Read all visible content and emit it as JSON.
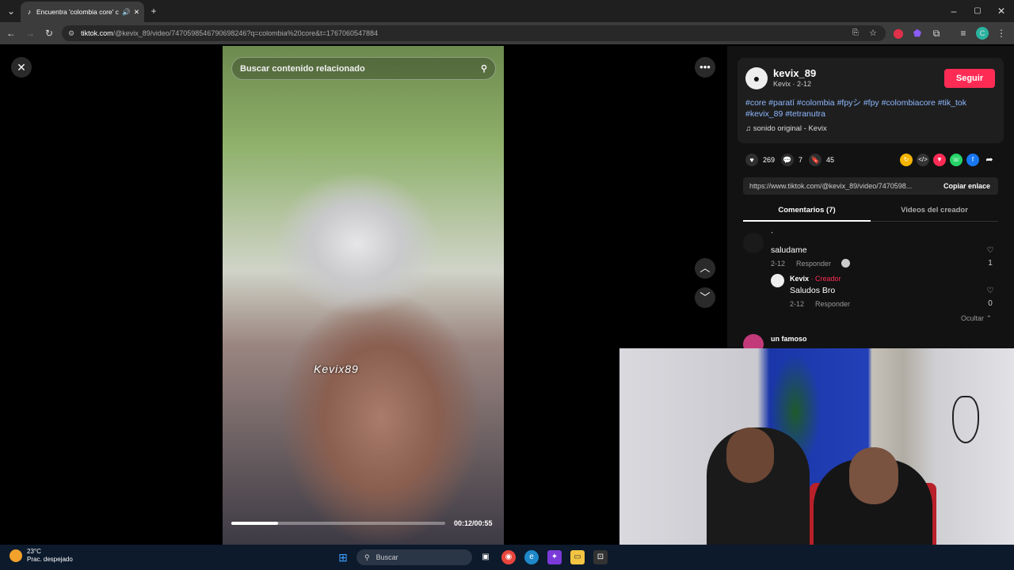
{
  "browser": {
    "tab_title": "Encuentra 'colombia core' c",
    "url_host": "tiktok.com",
    "url_path": "/@kevix_89/video/7470598546790698246?q=colombia%20core&t=1767060547884"
  },
  "video": {
    "search_placeholder": "Buscar contenido relacionado",
    "watermark": "Kevix89",
    "timecode": "00:12/00:55",
    "progress": 0.22
  },
  "creator": {
    "username": "kevix_89",
    "subline": "Kevix · 2-12",
    "follow_label": "Seguir",
    "description": "#core #paratí #colombia #fpyシ #fpy #colombiacore #tik_tok #kevix_89 #tetranutra",
    "sound": "sonido original - Kevix"
  },
  "stats": {
    "likes": "269",
    "comments": "7",
    "saves": "45"
  },
  "share": {
    "url": "https://www.tiktok.com/@kevix_89/video/7470598...",
    "copy_label": "Copiar enlace"
  },
  "tabs": {
    "comments": "Comentarios (7)",
    "creator_videos": "Videos del creador"
  },
  "comments": [
    {
      "name": "`",
      "text": "saludame",
      "date": "2-12",
      "reply_label": "Responder",
      "likes": "1",
      "reply": {
        "name": "Kevix",
        "badge": "· Creador",
        "text": "Saludos Bro",
        "date": "2-12",
        "reply_label": "Responder",
        "likes": "0"
      },
      "hide_label": "Ocultar"
    },
    {
      "name": "un famoso"
    }
  ],
  "taskbar": {
    "temp": "23°C",
    "weather": "Prac. despejado",
    "search_placeholder": "Buscar"
  },
  "colors": {
    "accent": "#fe2c55",
    "hashtag": "#8fb8ff"
  }
}
